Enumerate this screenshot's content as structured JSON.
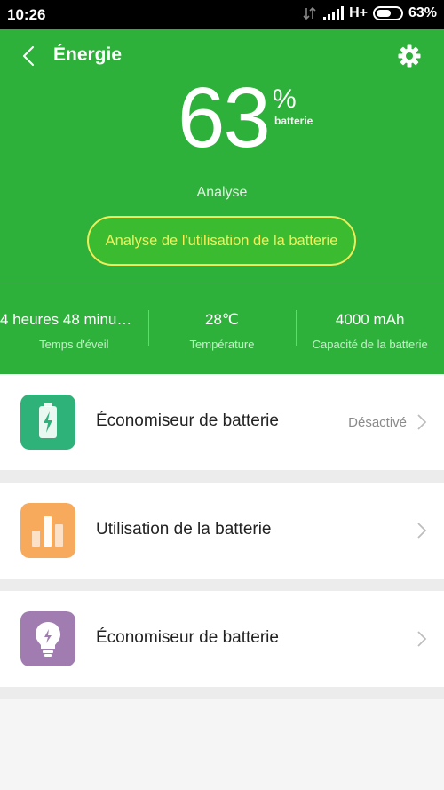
{
  "status_bar": {
    "time": "10:26",
    "network": "H+",
    "battery_percent": "63%"
  },
  "header": {
    "title": "Énergie",
    "battery_value": "63",
    "percent_sign": "%",
    "battery_word": "batterie",
    "analyse_label": "Analyse",
    "analyse_button": "Analyse de l'utilisation de la batterie"
  },
  "stats": [
    {
      "value": "4 heures 48 minu…",
      "label": "Temps d'éveil"
    },
    {
      "value": "28℃",
      "label": "Température"
    },
    {
      "value": "4000 mAh",
      "label": "Capacité de la batterie"
    }
  ],
  "rows": [
    {
      "label": "Économiseur de batterie",
      "status": "Désactivé",
      "icon": "battery-charging-icon",
      "color": "#2fb27a"
    },
    {
      "label": "Utilisation de la batterie",
      "icon": "bar-chart-icon",
      "color": "#f7a95c"
    },
    {
      "label": "Économiseur de batterie",
      "icon": "lightbulb-icon",
      "color": "#a17cb0"
    }
  ],
  "colors": {
    "accent_green": "#2eb13b",
    "button_yellow": "#f5ef5a"
  }
}
